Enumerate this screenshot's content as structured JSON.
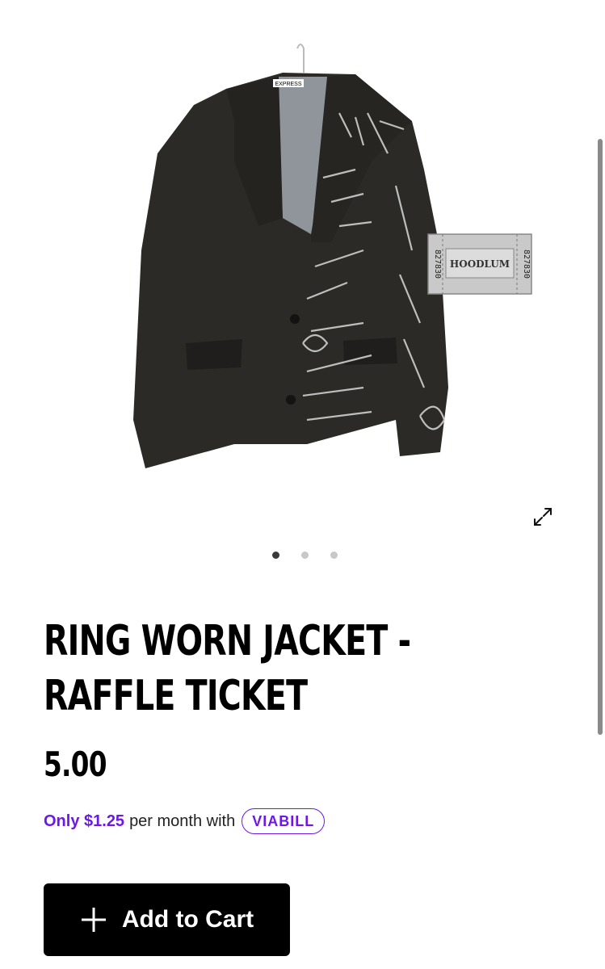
{
  "product": {
    "title": "RING WORN JACKET - RAFFLE TICKET",
    "price": "5.00",
    "image_alt": "Black blazer hand-painted with RELENTLESS text, with HOODLUM raffle ticket 827830",
    "ticket": {
      "number": "827830",
      "name": "HOODLUM"
    },
    "tag": "EXPRESS"
  },
  "gallery": {
    "slide_count": 3,
    "active_slide": 1,
    "expand_icon": "expand-icon"
  },
  "viabill": {
    "only_text": "Only $1.25",
    "rest_text": "per month with",
    "logo_text": "VIABILL",
    "accent_color": "#6c18e6"
  },
  "cart": {
    "button_label": "Add to Cart",
    "icon": "plus-icon"
  }
}
